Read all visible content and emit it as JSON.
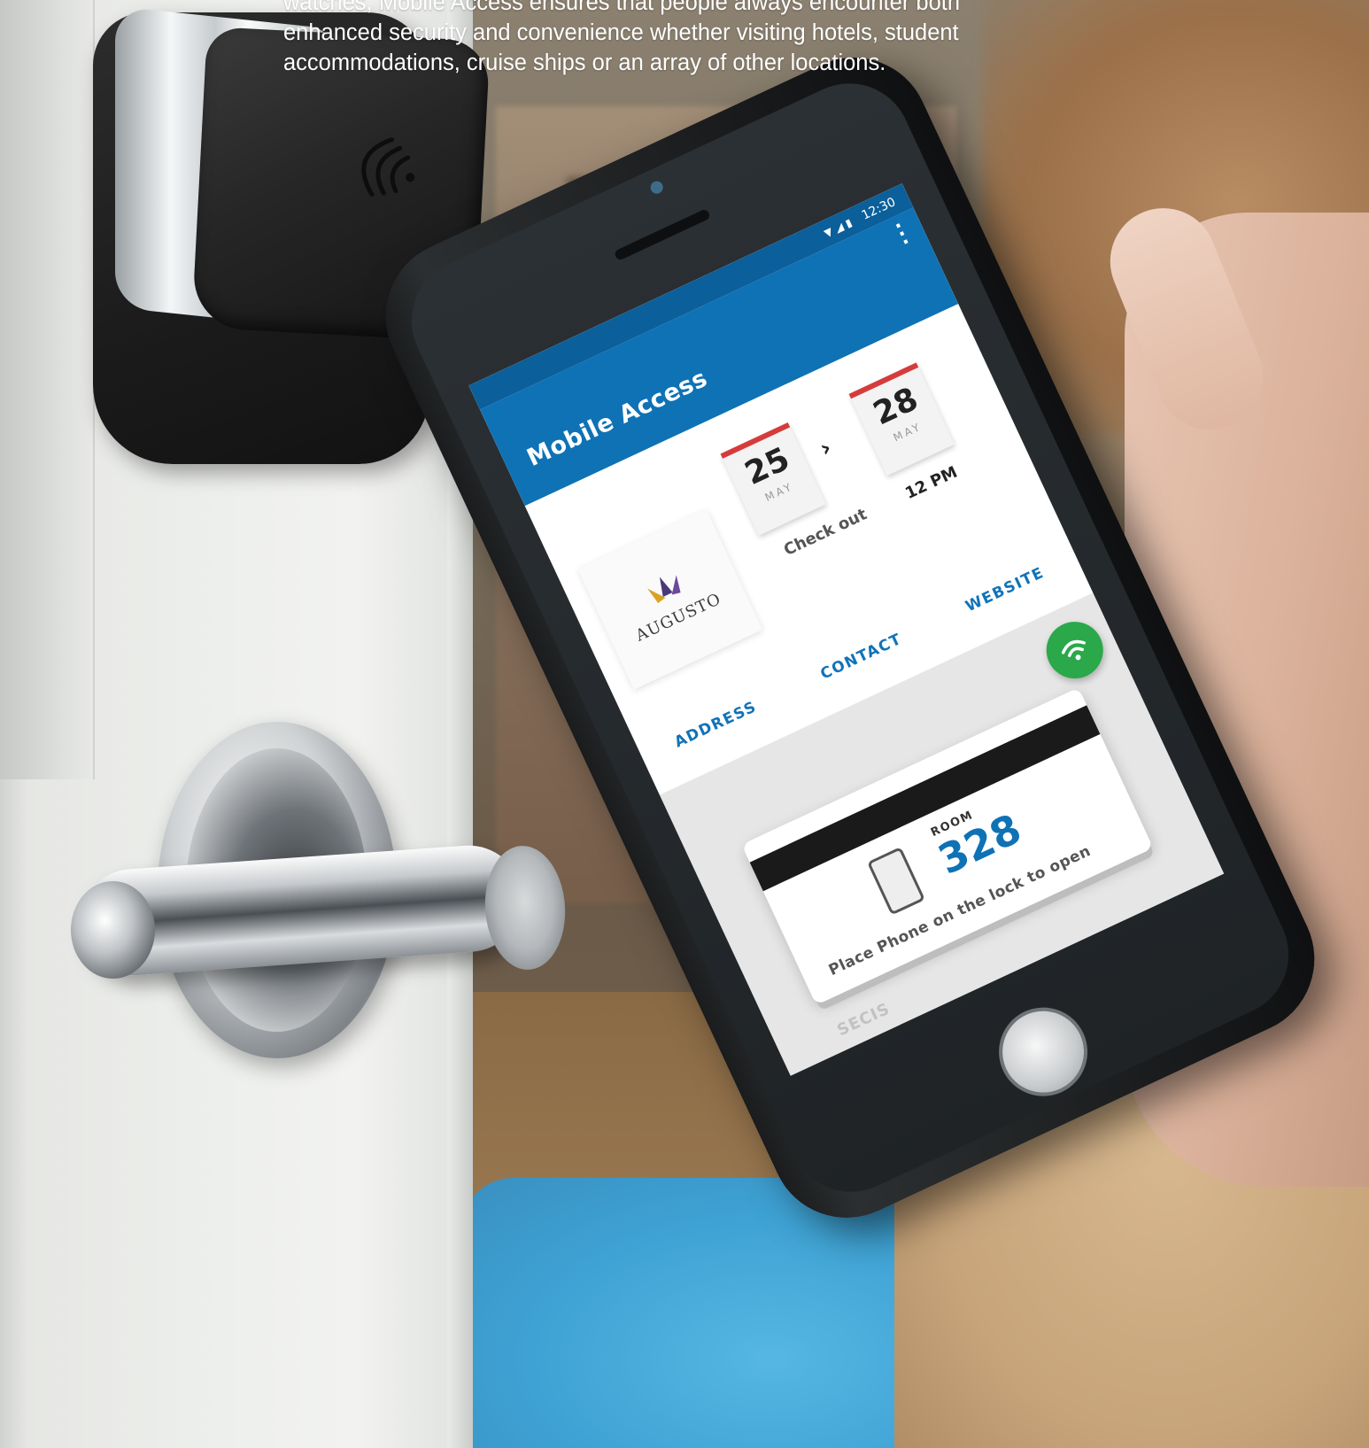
{
  "caption": {
    "lines": [
      "watches, Mobile Access ensures that people always encounter both",
      "enhanced security and convenience whether visiting hotels, student",
      "accommodations, cruise ships or an array of other locations."
    ]
  },
  "phone": {
    "status_time": "12:30",
    "app_title": "Mobile Access",
    "hotel_name": "AUGUSTO",
    "check_in": {
      "day": "25",
      "month": "MAY"
    },
    "check_out": {
      "day": "28",
      "month": "MAY",
      "label": "Check out",
      "time": "12 PM"
    },
    "links": [
      "ADDRESS",
      "CONTACT",
      "WEBSITE"
    ],
    "room_label": "ROOM",
    "room_number": "328",
    "card_hint": "Place Phone on the lock to open",
    "brand": "SECIS"
  },
  "colors": {
    "app_bar": "#0f72b5",
    "link": "#1173b8",
    "nfc_badge": "#2aa84a",
    "calendar_accent": "#d63b3b"
  },
  "icons": [
    "nfc-icon",
    "wifi-signal-icon",
    "battery-icon",
    "overflow-menu-icon",
    "phone-icon",
    "hotel-crown-icon"
  ]
}
